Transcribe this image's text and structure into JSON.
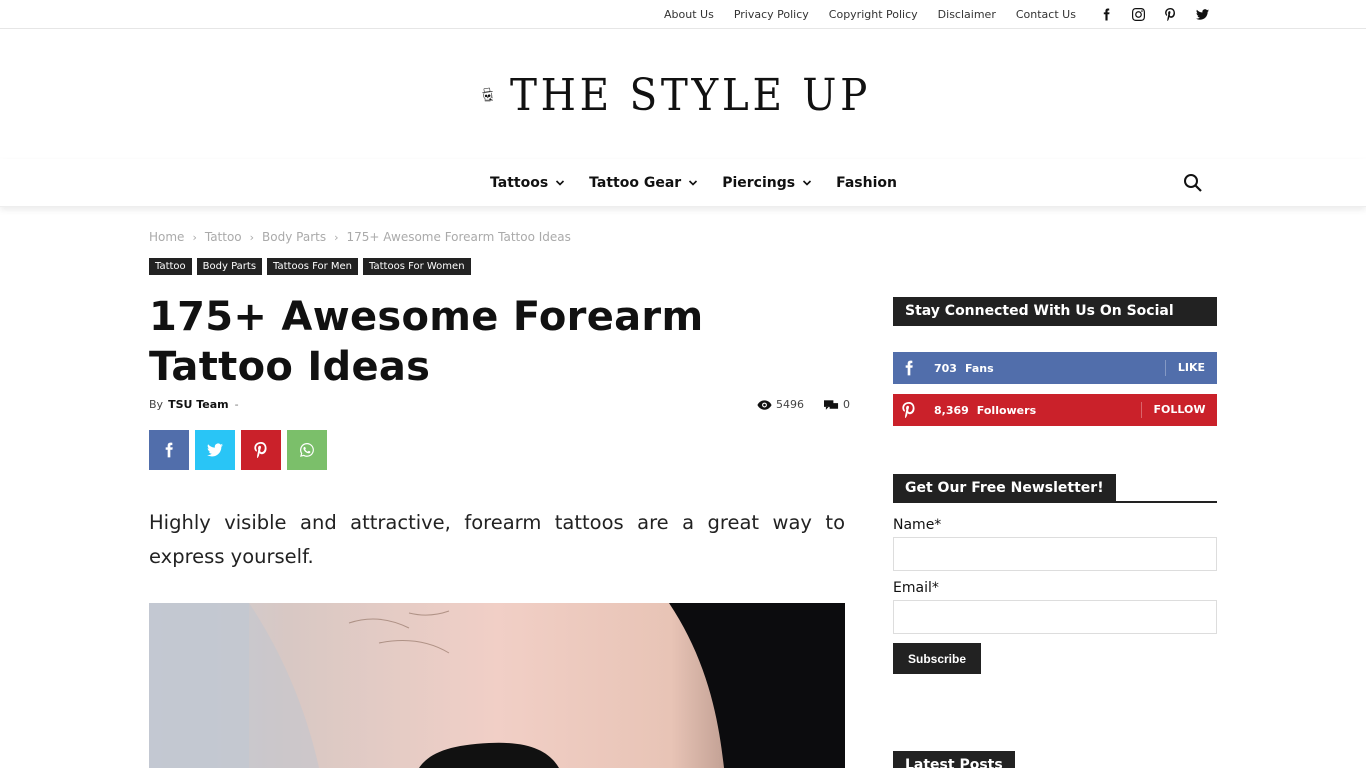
{
  "topbar": {
    "links": [
      "About Us",
      "Privacy Policy",
      "Copyright Policy",
      "Disclaimer",
      "Contact Us"
    ],
    "social_icons": [
      "facebook-icon",
      "instagram-icon",
      "pinterest-icon",
      "twitter-icon"
    ]
  },
  "logo": {
    "text": "THE STYLE UP"
  },
  "nav": {
    "items": [
      {
        "label": "Tattoos",
        "dropdown": true
      },
      {
        "label": "Tattoo Gear",
        "dropdown": true
      },
      {
        "label": "Piercings",
        "dropdown": true
      },
      {
        "label": "Fashion",
        "dropdown": false
      }
    ]
  },
  "breadcrumb": [
    "Home",
    "Tattoo",
    "Body Parts",
    "175+ Awesome Forearm Tattoo Ideas"
  ],
  "categories": [
    "Tattoo",
    "Body Parts",
    "Tattoos For Men",
    "Tattoos For Women"
  ],
  "article": {
    "title": "175+ Awesome Forearm Tattoo Ideas",
    "by_label": "By",
    "author": "TSU Team",
    "dash": "-",
    "views": "5496",
    "comments": "0",
    "intro": "Highly visible and attractive, forearm tattoos are a great way to express yourself."
  },
  "share_buttons": [
    {
      "name": "facebook",
      "color": "#516eab"
    },
    {
      "name": "twitter",
      "color": "#29c5f6"
    },
    {
      "name": "pinterest",
      "color": "#ca212a"
    },
    {
      "name": "whatsapp",
      "color": "#7bbf6a"
    }
  ],
  "sidebar": {
    "social_heading": "Stay Connected With Us On Social Media!",
    "facebook": {
      "count": "703",
      "label": "Fans",
      "action": "LIKE",
      "color": "#516eab"
    },
    "pinterest": {
      "count": "8,369",
      "label": "Followers",
      "action": "FOLLOW",
      "color": "#ca212a"
    },
    "newsletter_heading": "Get Our Free Newsletter!",
    "name_label": "Name*",
    "email_label": "Email*",
    "subscribe_label": "Subscribe",
    "latest_heading": "Latest Posts"
  }
}
